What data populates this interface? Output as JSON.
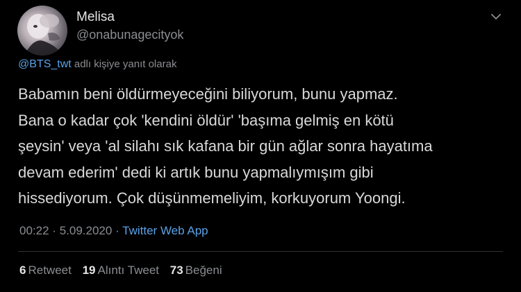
{
  "author": {
    "name": "Melisa",
    "handle": "@onabunagecityok"
  },
  "reply": {
    "mention": "@BTS_twt",
    "suffix": "adlı kişiye yanıt olarak"
  },
  "tweet": {
    "text": "Babamın beni öldürmeyeceğini biliyorum, bunu yapmaz.\nBana o kadar çok 'kendini öldür' 'başıma gelmiş en kötü\nşeysin' veya 'al silahı sık kafana bir gün ağlar sonra hayatıma\ndevam ederim' dedi ki artık bunu yapmalıymışım gibi\nhissediyorum. Çok düşünmemeliyim, korkuyorum Yoongi."
  },
  "meta": {
    "time": "00:22",
    "sep1": "·",
    "date": "5.09.2020",
    "sep2": "·",
    "app": "Twitter Web App"
  },
  "stats": {
    "retweets_count": "6",
    "retweets_label": "Retweet",
    "quotes_count": "19",
    "quotes_label": "Alıntı Tweet",
    "likes_count": "73",
    "likes_label": "Beğeni"
  },
  "colors": {
    "background": "#000000",
    "link": "#5aa2e8",
    "muted": "#8b8d91",
    "text": "#d9d9d9"
  },
  "icons": {
    "menu": "chevron-down-icon"
  }
}
